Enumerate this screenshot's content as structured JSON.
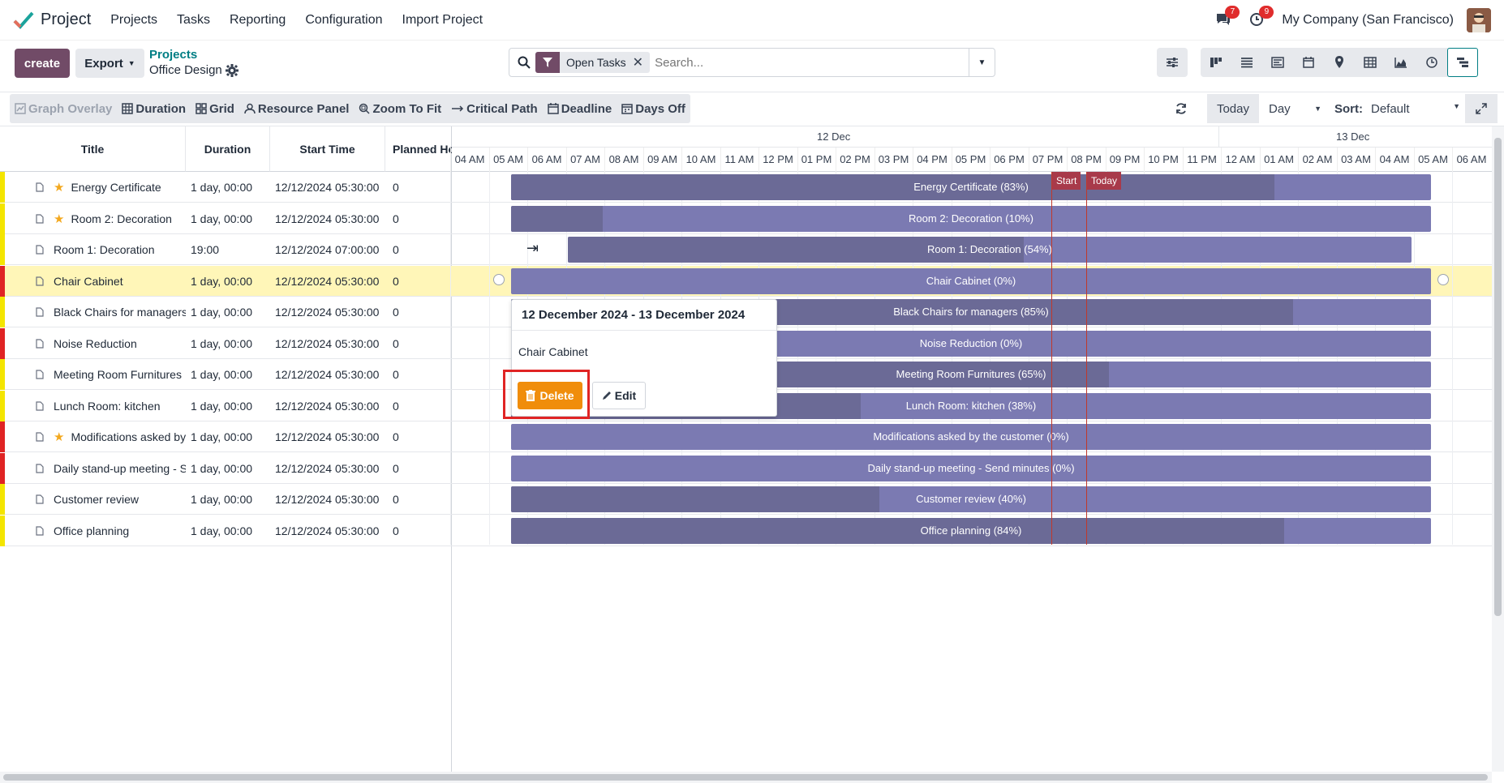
{
  "app": {
    "name": "Project"
  },
  "nav": {
    "menu": [
      "Projects",
      "Tasks",
      "Reporting",
      "Configuration",
      "Import Project"
    ],
    "messages_count": "7",
    "activities_count": "9",
    "company": "My Company (San Francisco)"
  },
  "control": {
    "create_label": "create",
    "export_label": "Export",
    "breadcrumb_parent": "Projects",
    "breadcrumb_current": "Office Design"
  },
  "search": {
    "facet": "Open Tasks",
    "placeholder": "Search..."
  },
  "toolbar": {
    "items": [
      "Graph Overlay",
      "Duration",
      "Grid",
      "Resource Panel",
      "Zoom To Fit",
      "Critical Path",
      "Deadline",
      "Days Off"
    ],
    "today": "Today",
    "scale": "Day",
    "sort_label": "Sort:",
    "sort_value": "Default"
  },
  "columns": [
    "Title",
    "Duration",
    "Start Time",
    "Planned Ho"
  ],
  "rows": [
    {
      "title": "Energy Certificate",
      "duration": "1 day, 00:00",
      "start": "12/12/2024 05:30:00",
      "planned": "0",
      "starred": true,
      "band": "#f4e500"
    },
    {
      "title": "Room 2: Decoration",
      "duration": "1 day, 00:00",
      "start": "12/12/2024 05:30:00",
      "planned": "0",
      "starred": true,
      "band": "#f4e500"
    },
    {
      "title": "Room 1: Decoration",
      "duration": "19:00",
      "start": "12/12/2024 07:00:00",
      "planned": "0",
      "starred": false,
      "band": "#f4e500"
    },
    {
      "title": "Chair Cabinet",
      "duration": "1 day, 00:00",
      "start": "12/12/2024 05:30:00",
      "planned": "0",
      "starred": false,
      "band": "#e02424"
    },
    {
      "title": "Black Chairs for managers",
      "duration": "1 day, 00:00",
      "start": "12/12/2024 05:30:00",
      "planned": "0",
      "starred": false,
      "band": "#f4e500"
    },
    {
      "title": "Noise Reduction",
      "duration": "1 day, 00:00",
      "start": "12/12/2024 05:30:00",
      "planned": "0",
      "starred": false,
      "band": "#e02424"
    },
    {
      "title": "Meeting Room Furnitures",
      "duration": "1 day, 00:00",
      "start": "12/12/2024 05:30:00",
      "planned": "0",
      "starred": false,
      "band": "#f4e500"
    },
    {
      "title": "Lunch Room: kitchen",
      "duration": "1 day, 00:00",
      "start": "12/12/2024 05:30:00",
      "planned": "0",
      "starred": false,
      "band": "#f4e500"
    },
    {
      "title": "Modifications asked by the customer",
      "duration": "1 day, 00:00",
      "start": "12/12/2024 05:30:00",
      "planned": "0",
      "starred": true,
      "band": "#e02424"
    },
    {
      "title": "Daily stand-up meeting - Send minutes",
      "duration": "1 day, 00:00",
      "start": "12/12/2024 05:30:00",
      "planned": "0",
      "starred": false,
      "band": "#e02424"
    },
    {
      "title": "Customer review",
      "duration": "1 day, 00:00",
      "start": "12/12/2024 05:30:00",
      "planned": "0",
      "starred": false,
      "band": "#f4e500"
    },
    {
      "title": "Office planning",
      "duration": "1 day, 00:00",
      "start": "12/12/2024 05:30:00",
      "planned": "0",
      "starred": false,
      "band": "#f4e500"
    }
  ],
  "gantt": {
    "days": [
      "12 Dec",
      "13 Dec"
    ],
    "hours": [
      "04 AM",
      "05 AM",
      "06 AM",
      "07 AM",
      "08 AM",
      "09 AM",
      "10 AM",
      "11 AM",
      "12 PM",
      "01 PM",
      "02 PM",
      "03 PM",
      "04 PM",
      "05 PM",
      "06 PM",
      "07 PM",
      "08 PM",
      "09 PM",
      "10 PM",
      "11 PM",
      "12 AM",
      "01 AM",
      "02 AM",
      "03 AM",
      "04 AM",
      "05 AM",
      "06 AM"
    ],
    "start_label": "Start",
    "today_label": "Today",
    "bars": [
      {
        "label": "Energy Certificate (83%)",
        "progress": 0.83
      },
      {
        "label": "Room 2: Decoration (10%)",
        "progress": 0.1
      },
      {
        "label": "Room 1: Decoration (54%)",
        "progress": 0.54
      },
      {
        "label": "Chair Cabinet (0%)",
        "progress": 0
      },
      {
        "label": "Black Chairs for managers (85%)",
        "progress": 0.85
      },
      {
        "label": "Noise Reduction (0%)",
        "progress": 0
      },
      {
        "label": "Meeting Room Furnitures (65%)",
        "progress": 0.65
      },
      {
        "label": "Lunch Room: kitchen (38%)",
        "progress": 0.38
      },
      {
        "label": "Modifications asked by the customer (0%)",
        "progress": 0
      },
      {
        "label": "Daily stand-up meeting - Send minutes (0%)",
        "progress": 0
      },
      {
        "label": "Customer review (40%)",
        "progress": 0.4
      },
      {
        "label": "Office planning (84%)",
        "progress": 0.84
      }
    ]
  },
  "popover": {
    "title": "12 December 2024 - 13 December 2024",
    "body": "Chair Cabinet",
    "delete_label": "Delete",
    "edit_label": "Edit"
  },
  "colors": {
    "brand": "#714b67",
    "accent": "#017e84",
    "bar": "#7b7ab2",
    "bar_progress": "#6b6a96",
    "today_line": "#c0392b",
    "delete": "#f08d0b"
  }
}
